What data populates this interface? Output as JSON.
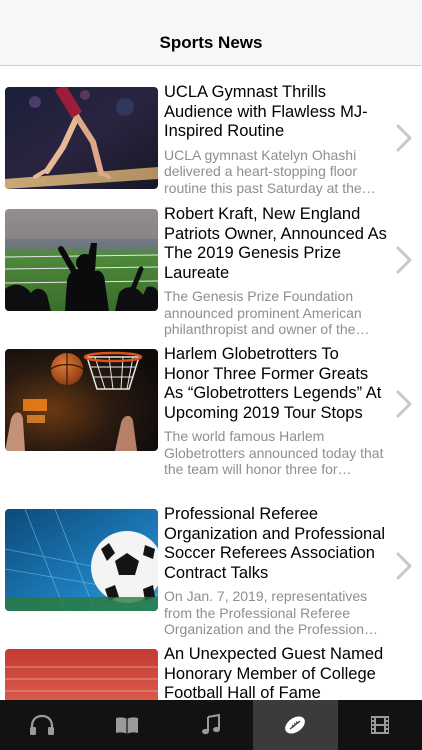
{
  "header": {
    "title": "Sports News"
  },
  "articles": [
    {
      "headline": "UCLA Gymnast Thrills Audience with Flawless MJ-Inspired Routine",
      "summary": "UCLA gymnast Katelyn Ohashi delivered a heart-stopping floor routine this past Saturday at the…"
    },
    {
      "headline": "Robert Kraft, New England Patriots Owner, Announced As The 2019 Genesis Prize Laureate",
      "summary": "The Genesis Prize Foundation announced prominent American philanthropist and owner of the…"
    },
    {
      "headline": "Harlem Globetrotters To Honor Three Former Greats As “Globetrotters Legends” At Upcoming 2019 Tour Stops",
      "summary": "The world famous Harlem Globetrotters announced today that the team will honor three for…"
    },
    {
      "headline": "Professional Referee Organization and Professional Soccer Referees Association Contract Talks",
      "summary": "On Jan. 7, 2019, representatives from the Professional Referee Organization and the Profession…"
    },
    {
      "headline": "An Unexpected Guest Named Honorary Member of College Football Hall of Fame",
      "summary": ""
    }
  ],
  "tabs": [
    {
      "icon": "headphones-icon"
    },
    {
      "icon": "book-icon"
    },
    {
      "icon": "music-note-icon"
    },
    {
      "icon": "football-icon",
      "active": true
    },
    {
      "icon": "film-icon"
    }
  ],
  "colors": {
    "navbar_bg": "#f7f7f7",
    "summary_text": "#8e8e93",
    "tabbar_bg": "#121212",
    "tab_active_bg": "#3b3b3b",
    "chevron": "#c7c7cc"
  }
}
